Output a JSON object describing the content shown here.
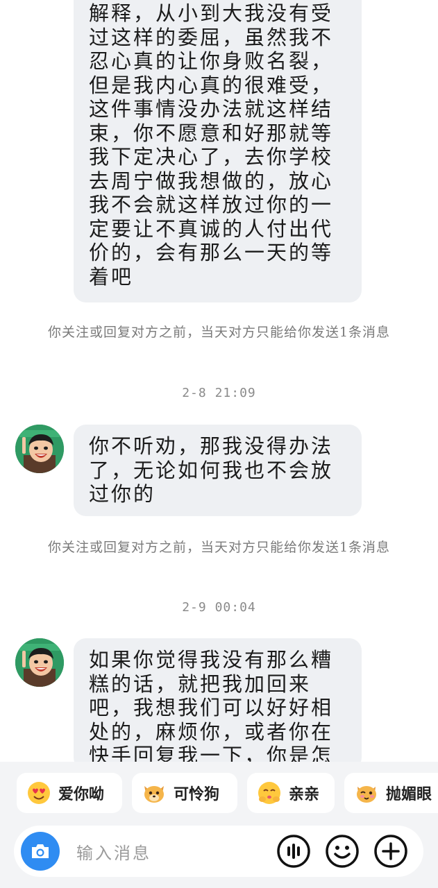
{
  "messages": [
    {
      "text": "解释，从小到大我没有受过这样的委屈，虽然我不忍心真的让你身败名裂，但是我内心真的很难受，这件事情没办法就这样结束，你不愿意和好那就等我下定决心了，去你学校去周宁做我想做的，放心我不会就这样放过你的一定要让不真诚的人付出代价的，会有那么一天的等着吧"
    },
    {
      "text": "你不听劝，那我没得办法了，无论如何我也不会放过你的"
    },
    {
      "text": "如果你觉得我没有那么糟糕的话，就把我加回来吧，我想我们可以好好相处的，麻烦你，或者你在快手回复我一下，你是怎"
    }
  ],
  "notices": [
    "你关注或回复对方之前，当天对方只能给你发送1条消息",
    "你关注或回复对方之前，当天对方只能给你发送1条消息"
  ],
  "timestamps": [
    "2-8 21:09",
    "2-9 00:04"
  ],
  "quick_replies": [
    {
      "label": "爱你呦",
      "icon": "heart-eyes-emoji-icon"
    },
    {
      "label": "可怜狗",
      "icon": "pitiful-dog-emoji-icon"
    },
    {
      "label": "亲亲",
      "icon": "kiss-emoji-icon"
    },
    {
      "label": "抛媚眼",
      "icon": "wink-emoji-icon"
    }
  ],
  "input": {
    "placeholder": "输入消息"
  },
  "colors": {
    "bubble": "#eef0f3",
    "camera": "#2f8cf2",
    "avatar_bg": "#2f9a63"
  }
}
